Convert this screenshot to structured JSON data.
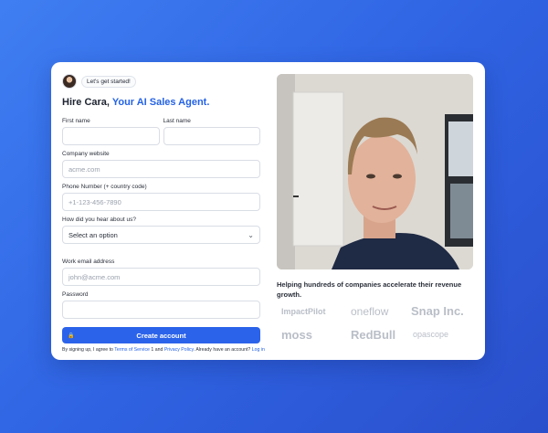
{
  "header": {
    "badge": "Let's get started!",
    "headline_prefix": "Hire Cara, ",
    "headline_accent": "Your AI Sales Agent."
  },
  "form": {
    "first_name": {
      "label": "First name",
      "value": "",
      "placeholder": ""
    },
    "last_name": {
      "label": "Last name",
      "value": "",
      "placeholder": ""
    },
    "company_website": {
      "label": "Company website",
      "placeholder": "acme.com"
    },
    "phone": {
      "label": "Phone Number (+ country code)",
      "placeholder": "+1-123-456-7890"
    },
    "referral": {
      "label": "How did you hear about us?",
      "selected": "Select an option"
    },
    "email": {
      "label": "Work email address",
      "placeholder": "john@acme.com"
    },
    "password": {
      "label": "Password",
      "value": ""
    },
    "submit_label": "Create account"
  },
  "terms": {
    "prefix": "By signing up, I agree to ",
    "tos": "Terms of Service",
    "middle": " 1 and ",
    "privacy": "Privacy Policy",
    "suffix": ". Already have an account? ",
    "login": "Log in"
  },
  "showcase": {
    "caption": "Helping hundreds of companies accelerate their revenue growth.",
    "logos": [
      "ImpactPilot",
      "oneflow",
      "Snap Inc.",
      "moss",
      "RedBull",
      "opascope"
    ]
  },
  "colors": {
    "accent": "#2462e6",
    "button": "#2b63ea",
    "bg_start": "#3f7ef2",
    "bg_end": "#2a4fcc"
  },
  "icons": [
    "avatar",
    "chevron-down-icon",
    "lock-icon"
  ]
}
